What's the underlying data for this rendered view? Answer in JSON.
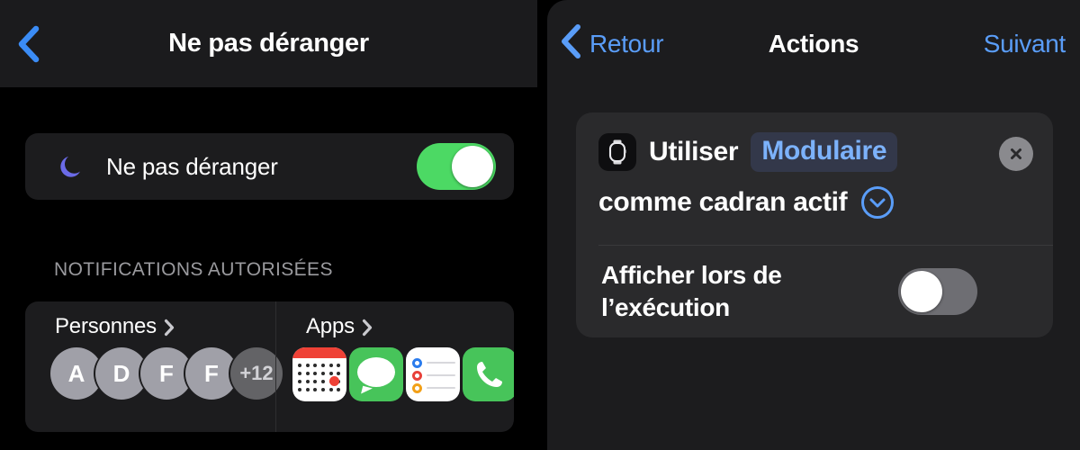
{
  "left_panel": {
    "nav": {
      "back_icon": "chevron-left-icon",
      "title": "Ne pas déranger"
    },
    "dnd_card": {
      "icon": "moon-icon",
      "label": "Ne pas déranger",
      "toggle_state": "on",
      "toggle_color": "#4cd964"
    },
    "section_header": "NOTIFICATIONS AUTORISÉES",
    "notifications": {
      "people": {
        "label": "Personnes",
        "chevron": "chevron-right-icon",
        "avatars": [
          {
            "initial": "A",
            "type": "person"
          },
          {
            "initial": "D",
            "type": "person"
          },
          {
            "initial": "F",
            "type": "person"
          },
          {
            "initial": "F",
            "type": "person"
          },
          {
            "initial": "+12",
            "type": "overflow"
          }
        ]
      },
      "apps": {
        "label": "Apps",
        "chevron": "chevron-right-icon",
        "icons": [
          {
            "name": "calendar-app-icon"
          },
          {
            "name": "messages-app-icon"
          },
          {
            "name": "reminders-app-icon"
          },
          {
            "name": "phone-app-icon"
          }
        ]
      }
    }
  },
  "right_panel": {
    "nav": {
      "back_icon": "chevron-left-icon",
      "back_label": "Retour",
      "title": "Actions",
      "next_label": "Suivant",
      "accent_color": "#5a9df8"
    },
    "action_card": {
      "app_icon": "apple-watch-icon",
      "text_before": "Utiliser",
      "parameter_value": "Modulaire",
      "text_after": "comme cadran actif",
      "expand_icon": "chevron-down-circle-icon",
      "close_icon": "close-icon",
      "parameter_color": "#7cb2fb",
      "show_when_run": {
        "label": "Afficher lors de l’exécution",
        "toggle_state": "off",
        "toggle_color": "#6e6e73"
      }
    }
  }
}
